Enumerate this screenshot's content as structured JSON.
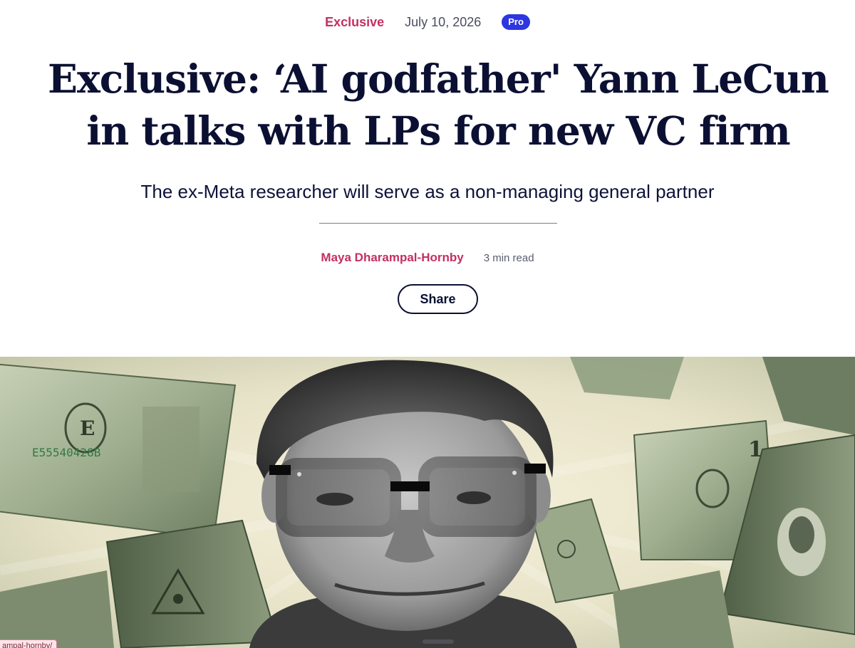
{
  "article": {
    "category": "Exclusive",
    "date": "July 10, 2026",
    "badge": "Pro",
    "headline": "Exclusive: ‘AI godfather' Yann LeCun in talks with LPs for new VC firm",
    "subheadline": "The ex-Meta researcher will serve as a non-managing general partner",
    "author": "Maya Dharampal-Hornby",
    "read_time": "3 min read",
    "share_label": "Share"
  },
  "overlay": {
    "url_fragment": "ampal-hornby/"
  },
  "colors": {
    "accent": "#c4305f",
    "pro_badge": "#2d36e0",
    "headline": "#0b1033"
  }
}
